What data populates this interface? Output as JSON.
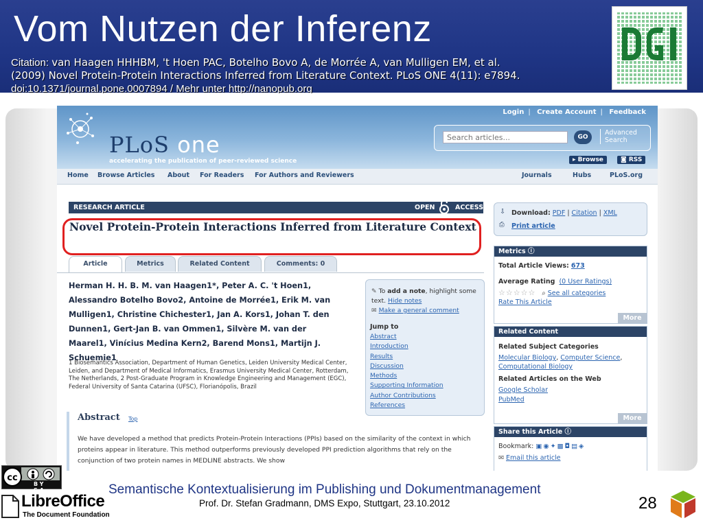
{
  "slide": {
    "title": "Vom Nutzen der Inferenz",
    "citation_label": "Citation: ",
    "citation_line1": "van Haagen HHHBM, 't Hoen PAC, Botelho Bovo A, de Morrée A, van Mulligen EM, et al.",
    "citation_line2": "(2009) Novel Protein-Protein Interactions Inferred from Literature Context. PLoS ONE 4(11): e7894.",
    "citation_line3": "doi:10.1371/journal.pone.0007894 / Mehr unter http://nanopub.org",
    "footer_title": "Semantische Kontextualisierung im Publishing und Dokumentmanagement",
    "footer_sub": "Prof. Dr. Stefan Gradmann, DMS Expo, Stuttgart, 23.10.2012",
    "page_number": "28",
    "cc_label": "BY SA",
    "libreoffice_name": "LibreOffice",
    "libreoffice_sub": "The Document Foundation",
    "accent": "#1f3585"
  },
  "plos": {
    "toplinks": {
      "login": "Login",
      "create": "Create Account",
      "feedback": "Feedback"
    },
    "logo_word": "PLoS",
    "logo_one": "one",
    "tagline": "accelerating the publication of peer-reviewed science",
    "search_placeholder": "Search articles...",
    "go": "GO",
    "advanced1": "Advanced",
    "advanced2": "Search",
    "browse": "Browse",
    "rss": "RSS",
    "nav_left": [
      "Home",
      "Browse Articles",
      "About",
      "For Readers",
      "For Authors and Reviewers"
    ],
    "nav_right": [
      "Journals",
      "Hubs",
      "PLoS.org"
    ]
  },
  "article": {
    "type_label": "RESEARCH ARTICLE",
    "open": "OPEN",
    "access": "ACCESS",
    "title": "Novel Protein-Protein Interactions Inferred from Literature Context",
    "tabs": [
      "Article",
      "Metrics",
      "Related Content",
      "Comments: 0"
    ],
    "authors_lines": [
      "Herman H. H. B. M. van Haagen1*, Peter A. C. 't Hoen1,",
      "Alessandro Botelho Bovo2, Antoine de Morrée1, Erik M. van",
      "Mulligen1, Christine Chichester1, Jan A. Kors1, Johan T. den",
      "Dunnen1, Gert-Jan B. van Ommen1, Silvère M. van der",
      "Maarel1, Vinícius Medina Kern2, Barend Mons1, Martijn J.",
      "Schuemie1"
    ],
    "affiliations": "1 Biosemantics Association, Department of Human Genetics, Leiden University Medical Center, Leiden, and Department of Medical Informatics, Erasmus University Medical Center, Rotterdam, The Netherlands, 2 Post-Graduate Program in Knowledge Engineering and Management (EGC), Federal University of Santa Catarina (UFSC), Florianópolis, Brazil",
    "abstract_heading": "Abstract",
    "abstract_top": "Top",
    "abstract_text": "We have developed a method that predicts Protein-Protein Interactions (PPIs) based on the similarity of the context in which proteins appear in literature. This method outperforms previously developed PPI prediction algorithms that rely on the conjunction of two protein names in MEDLINE abstracts. We show"
  },
  "notebox": {
    "to": "To ",
    "add_note": "add a note",
    "rest": ", highlight some text. ",
    "hide_notes": "Hide notes",
    "general": "Make a general comment",
    "jump_to": "Jump to",
    "jump_items": [
      "Abstract",
      "Introduction",
      "Results",
      "Discussion",
      "Methods",
      "Supporting Information",
      "Author Contributions",
      "References"
    ]
  },
  "right": {
    "download_label": "Download:",
    "pdf": "PDF",
    "citation": "Citation",
    "xml": "XML",
    "print": "Print article",
    "metrics_h": "Metrics",
    "total_views_label": "Total Article Views:",
    "total_views": "673",
    "avg_rating_label": "Average Rating",
    "user_ratings": "(0 User Ratings)",
    "see_all": "See all categories",
    "rate": "Rate This Article",
    "more": "More",
    "related_h": "Related Content",
    "subject_h": "Related Subject Categories",
    "subjects": [
      "Molecular Biology",
      "Computer Science",
      "Computational Biology"
    ],
    "web_h": "Related Articles on the Web",
    "web_items": [
      "Google Scholar",
      "PubMed"
    ],
    "share_h": "Share this Article",
    "bookmark": "Bookmark:",
    "email": "Email this article"
  }
}
